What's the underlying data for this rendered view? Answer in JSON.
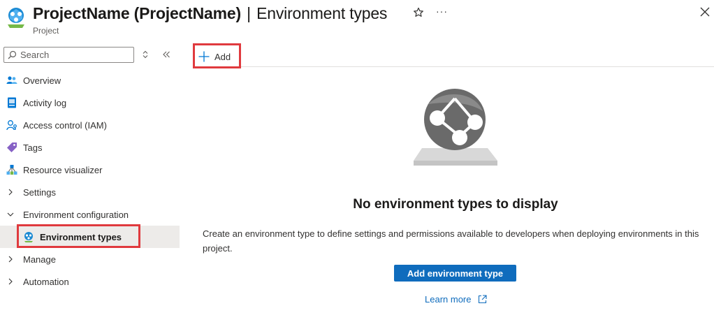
{
  "header": {
    "resource_name": "ProjectName (ProjectName)",
    "separator": "|",
    "page": "Environment types",
    "subtitle": "Project",
    "more_label": "···"
  },
  "search": {
    "placeholder": "Search"
  },
  "sidebar": {
    "items": [
      {
        "label": "Overview",
        "icon": "overview-people-icon"
      },
      {
        "label": "Activity log",
        "icon": "activity-log-icon"
      },
      {
        "label": "Access control (IAM)",
        "icon": "access-control-icon"
      },
      {
        "label": "Tags",
        "icon": "tag-icon"
      },
      {
        "label": "Resource visualizer",
        "icon": "resource-visualizer-icon"
      },
      {
        "label": "Settings",
        "icon": "chevron-right-icon"
      },
      {
        "label": "Environment configuration",
        "icon": "chevron-down-icon"
      },
      {
        "label": "Environment types",
        "icon": "environment-types-icon",
        "selected": true
      },
      {
        "label": "Manage",
        "icon": "chevron-right-icon"
      },
      {
        "label": "Automation",
        "icon": "chevron-right-icon"
      }
    ]
  },
  "toolbar": {
    "add_label": "Add"
  },
  "empty_state": {
    "title": "No environment types to display",
    "description": "Create an environment type to define settings and permissions available to developers when deploying environments in this project.",
    "button_label": "Add environment type",
    "learn_more": "Learn more"
  },
  "colors": {
    "accent": "#0f6cbd",
    "highlight": "#e03a3e",
    "selected_bg": "#edebe9"
  }
}
